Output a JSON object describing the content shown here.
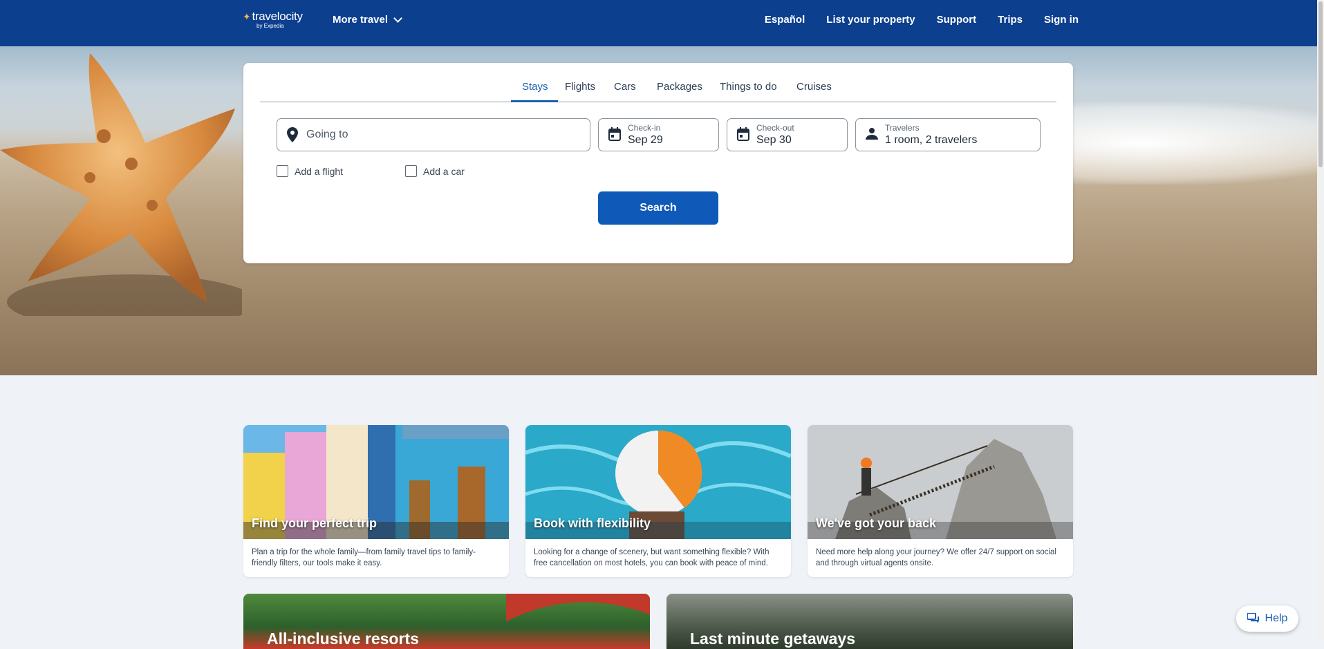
{
  "header": {
    "logo_text": "travelocity",
    "logo_byline": "by Expedia",
    "more_travel": "More travel",
    "nav": [
      "Español",
      "List your property",
      "Support",
      "Trips",
      "Sign in"
    ]
  },
  "search": {
    "tabs": [
      "Stays",
      "Flights",
      "Cars",
      "Packages",
      "Things to do",
      "Cruises"
    ],
    "active_tab": "Stays",
    "going_to_placeholder": "Going to",
    "checkin_label": "Check-in",
    "checkin_value": "Sep 29",
    "checkout_label": "Check-out",
    "checkout_value": "Sep 30",
    "travelers_label": "Travelers",
    "travelers_value": "1 room, 2 travelers",
    "add_flight": "Add a flight",
    "add_car": "Add a car",
    "button": "Search"
  },
  "cards": [
    {
      "title": "Find your perfect trip",
      "desc": "Plan a trip for the whole family—from family travel tips to family-friendly filters, our tools make it easy."
    },
    {
      "title": "Book with flexibility",
      "desc": "Looking for a change of scenery, but want something flexible? With free cancellation on most hotels, you can book with peace of mind."
    },
    {
      "title": "We've got your back",
      "desc": "Need more help along your journey? We offer 24/7 support on social and through virtual agents onsite."
    }
  ],
  "promos": [
    {
      "title": "All-inclusive resorts"
    },
    {
      "title": "Last minute getaways"
    }
  ],
  "help": "Help",
  "colors": {
    "brand": "#0d3f8f",
    "accent": "#0f5ab8"
  }
}
